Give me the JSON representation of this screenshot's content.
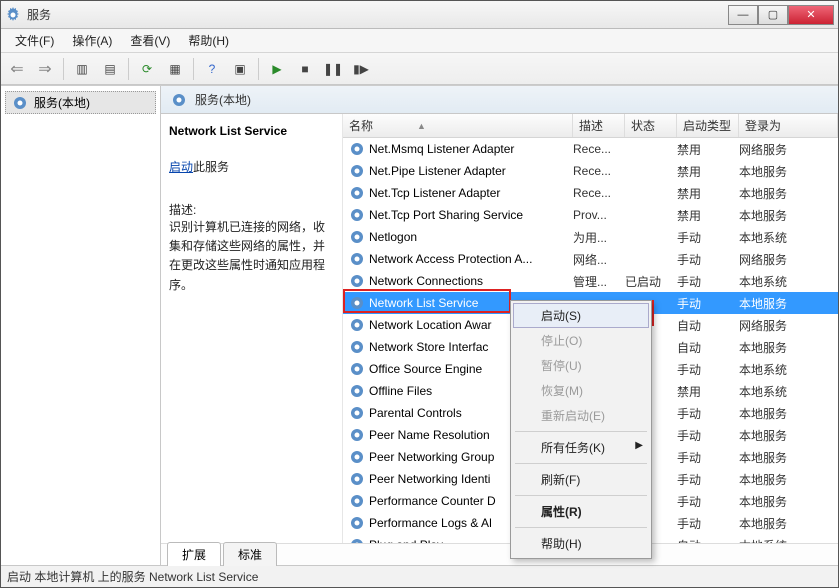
{
  "titlebar": {
    "title": "服务"
  },
  "winbtns": {
    "min": "—",
    "max": "▢",
    "close": "✕"
  },
  "menu": {
    "file": "文件(F)",
    "action": "操作(A)",
    "view": "查看(V)",
    "help": "帮助(H)"
  },
  "leftpane": {
    "node": "服务(本地)"
  },
  "panel": {
    "heading": "服务(本地)"
  },
  "detail": {
    "svcname": "Network List Service",
    "start_link": "启动",
    "start_suffix": "此服务",
    "desc_label": "描述:",
    "desc_text": "识别计算机已连接的网络，收集和存储这些网络的属性，并在更改这些属性时通知应用程序。"
  },
  "columns": {
    "name": "名称",
    "desc": "描述",
    "state": "状态",
    "startup": "启动类型",
    "logon": "登录为"
  },
  "services": [
    {
      "name": "Net.Msmq Listener Adapter",
      "desc": "Rece...",
      "state": "",
      "startup": "禁用",
      "logon": "网络服务"
    },
    {
      "name": "Net.Pipe Listener Adapter",
      "desc": "Rece...",
      "state": "",
      "startup": "禁用",
      "logon": "本地服务"
    },
    {
      "name": "Net.Tcp Listener Adapter",
      "desc": "Rece...",
      "state": "",
      "startup": "禁用",
      "logon": "本地服务"
    },
    {
      "name": "Net.Tcp Port Sharing Service",
      "desc": "Prov...",
      "state": "",
      "startup": "禁用",
      "logon": "本地服务"
    },
    {
      "name": "Netlogon",
      "desc": "为用...",
      "state": "",
      "startup": "手动",
      "logon": "本地系统"
    },
    {
      "name": "Network Access Protection A...",
      "desc": "网络...",
      "state": "",
      "startup": "手动",
      "logon": "网络服务"
    },
    {
      "name": "Network Connections",
      "desc": "管理...",
      "state": "已启动",
      "startup": "手动",
      "logon": "本地系统"
    },
    {
      "name": "Network List Service",
      "desc": "",
      "state": "",
      "startup": "手动",
      "logon": "本地服务"
    },
    {
      "name": "Network Location Awar",
      "desc": "",
      "state": "",
      "startup": "自动",
      "logon": "网络服务"
    },
    {
      "name": "Network Store Interfac",
      "desc": "",
      "state": "",
      "startup": "自动",
      "logon": "本地服务"
    },
    {
      "name": "Office Source Engine",
      "desc": "",
      "state": "",
      "startup": "手动",
      "logon": "本地系统"
    },
    {
      "name": "Offline Files",
      "desc": "",
      "state": "",
      "startup": "禁用",
      "logon": "本地系统"
    },
    {
      "name": "Parental Controls",
      "desc": "",
      "state": "",
      "startup": "手动",
      "logon": "本地服务"
    },
    {
      "name": "Peer Name Resolution",
      "desc": "",
      "state": "",
      "startup": "手动",
      "logon": "本地服务"
    },
    {
      "name": "Peer Networking Group",
      "desc": "",
      "state": "",
      "startup": "手动",
      "logon": "本地服务"
    },
    {
      "name": "Peer Networking Identi",
      "desc": "",
      "state": "",
      "startup": "手动",
      "logon": "本地服务"
    },
    {
      "name": "Performance Counter D",
      "desc": "",
      "state": "",
      "startup": "手动",
      "logon": "本地服务"
    },
    {
      "name": "Performance Logs & Al",
      "desc": "",
      "state": "",
      "startup": "手动",
      "logon": "本地服务"
    },
    {
      "name": "Plug and Play",
      "desc": "",
      "state": "",
      "startup": "自动",
      "logon": "本地系统"
    }
  ],
  "selected_index": 7,
  "context_menu": {
    "start": "启动(S)",
    "stop": "停止(O)",
    "pause": "暂停(U)",
    "resume": "恢复(M)",
    "restart": "重新启动(E)",
    "alltasks": "所有任务(K)",
    "refresh": "刷新(F)",
    "properties": "属性(R)",
    "help": "帮助(H)"
  },
  "tabs": {
    "extended": "扩展",
    "standard": "标准"
  },
  "statusbar": "启动 本地计算机 上的服务 Network List Service"
}
